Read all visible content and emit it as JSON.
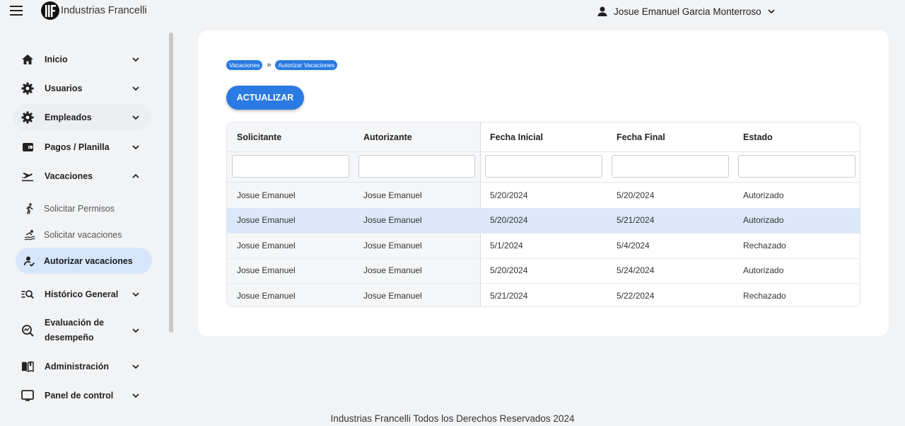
{
  "app": {
    "title": "Industrias Francelli"
  },
  "user": {
    "name": "Josue Emanuel Garcia Monterroso"
  },
  "sidebar": {
    "items": [
      {
        "label": "Inicio",
        "icon": "home-icon"
      },
      {
        "label": "Usuarios",
        "icon": "gear-icon"
      },
      {
        "label": "Empleados",
        "icon": "gear-icon"
      },
      {
        "label": "Pagos / Planilla",
        "icon": "wallet-icon"
      },
      {
        "label": "Vacaciones",
        "icon": "plane-icon",
        "expanded": true
      },
      {
        "label": "Histórico General",
        "icon": "history-search-icon"
      },
      {
        "label": "Evaluación de desempeño",
        "icon": "evaluation-icon"
      },
      {
        "label": "Administración",
        "icon": "book-icon"
      },
      {
        "label": "Panel de control",
        "icon": "monitor-icon"
      }
    ],
    "subitems": [
      {
        "label": "Solicitar Permisos",
        "icon": "walking-icon"
      },
      {
        "label": "Solicitar vacaciones",
        "icon": "person-swim-icon"
      },
      {
        "label": "Autorizar vacaciones",
        "icon": "user-check-icon",
        "active": true
      }
    ]
  },
  "breadcrumb": [
    "Vacaciones",
    "Autorizar Vacaciones"
  ],
  "breadcrumb_sep": "»",
  "toolbar": {
    "refresh_label": "ACTUALIZAR"
  },
  "table": {
    "columns": [
      "Solicitante",
      "Autorizante",
      "Fecha Inicial",
      "Fecha Final",
      "Estado"
    ],
    "rows": [
      [
        "Josue Emanuel",
        "Josue Emanuel",
        "5/20/2024",
        "5/20/2024",
        "Autorizado"
      ],
      [
        "Josue Emanuel",
        "Josue Emanuel",
        "5/20/2024",
        "5/21/2024",
        "Autorizado"
      ],
      [
        "Josue Emanuel",
        "Josue Emanuel",
        "5/1/2024",
        "5/4/2024",
        "Rechazado"
      ],
      [
        "Josue Emanuel",
        "Josue Emanuel",
        "5/20/2024",
        "5/24/2024",
        "Autorizado"
      ],
      [
        "Josue Emanuel",
        "Josue Emanuel",
        "5/21/2024",
        "5/22/2024",
        "Rechazado"
      ]
    ],
    "selected_row": 1
  },
  "footer": {
    "text": "Industrias Francelli Todos los Derechos Reservados 2024"
  },
  "colors": {
    "accent": "#2a7ae2",
    "active_nav": "#d6e6fa",
    "selected_row": "#dbe8f9"
  }
}
